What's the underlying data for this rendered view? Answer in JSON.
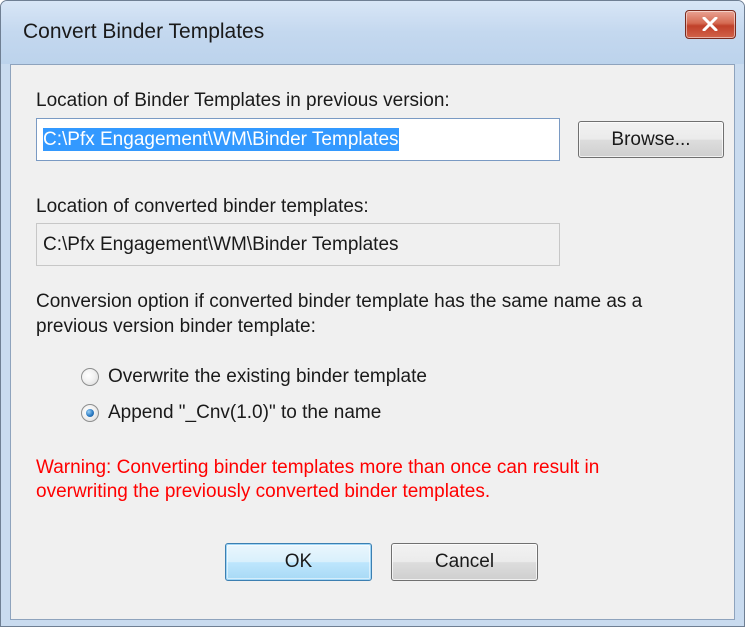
{
  "window": {
    "title": "Convert Binder Templates",
    "close_icon": "close-x-icon"
  },
  "source": {
    "label": "Location of Binder Templates in previous version:",
    "value": "C:\\Pfx Engagement\\WM\\Binder Templates",
    "browse_label": "Browse..."
  },
  "target": {
    "label": "Location of converted binder templates:",
    "value": "C:\\Pfx Engagement\\WM\\Binder Templates"
  },
  "conversion": {
    "prompt_line1": "Conversion option if converted binder template has the same name as a",
    "prompt_line2": "previous version binder template:",
    "options": [
      {
        "label": "Overwrite the existing binder template",
        "checked": false
      },
      {
        "label": "Append \"_Cnv(1.0)\" to the name",
        "checked": true
      }
    ]
  },
  "warning": {
    "line1": "Warning: Converting binder templates more than once can result in",
    "line2": "overwriting the previously converted binder templates.",
    "color": "#ff0000"
  },
  "buttons": {
    "ok_label": "OK",
    "cancel_label": "Cancel"
  }
}
